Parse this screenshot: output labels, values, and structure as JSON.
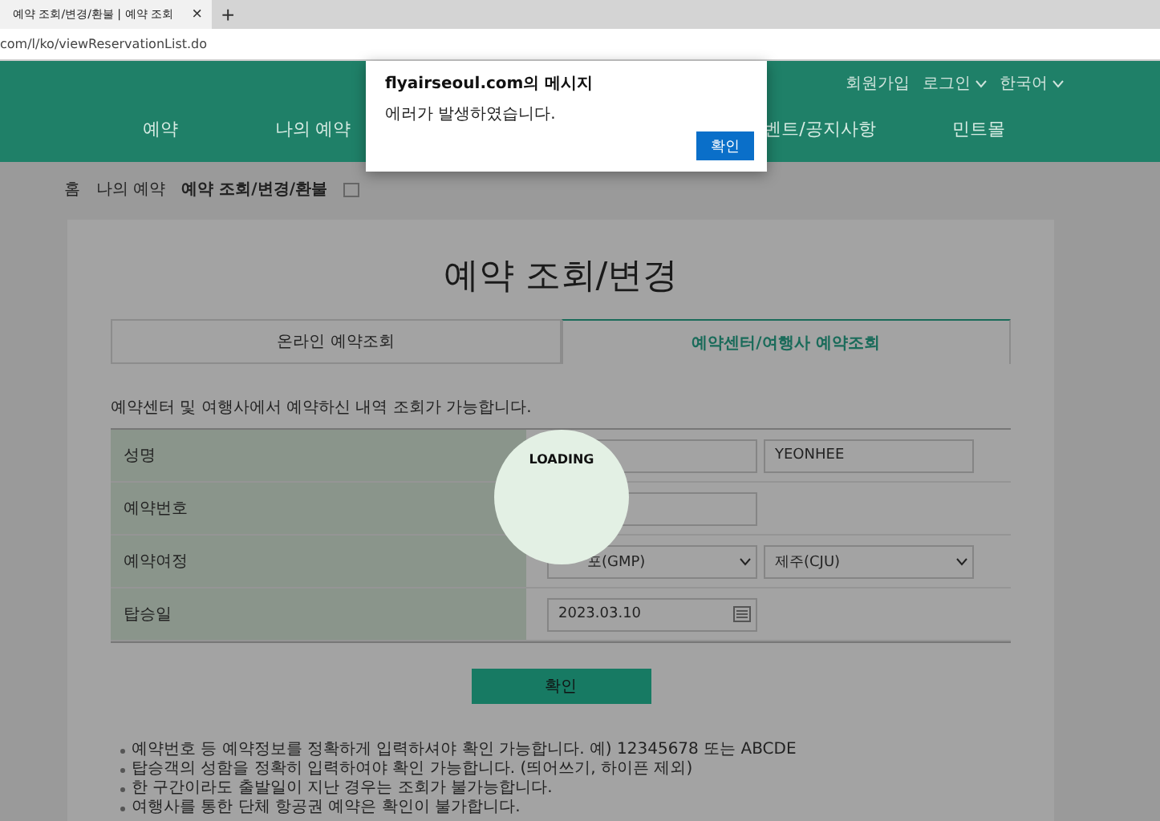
{
  "browser": {
    "tab_title": "예약 조회/변경/환불 | 예약 조회",
    "tab_close": "×",
    "new_tab": "+",
    "address": "com/l/ko/viewReservationList.do"
  },
  "header": {
    "top_links": [
      {
        "label": "회원가입",
        "caret": false
      },
      {
        "label": "로그인",
        "caret": true
      },
      {
        "label": "한국어",
        "caret": true
      }
    ],
    "nav": [
      "예약",
      "나의 예약",
      "벤트/공지사항",
      "민트몰"
    ]
  },
  "breadcrumb": [
    "홈",
    "나의 예약",
    "예약 조회/변경/환불"
  ],
  "dialog": {
    "title": "flyairseoul.com의 메시지",
    "message": "에러가 발생하였습니다.",
    "button": "확인"
  },
  "page_title": "예약 조회/변경",
  "tabs": [
    {
      "label": "온라인 예약조회",
      "selected": false
    },
    {
      "label": "예약센터/여행사 예약조회",
      "selected": true
    }
  ],
  "description": "예약센터 및 여행사에서 예약하신 내역 조회가 가능합니다.",
  "form": [
    {
      "label": "성명",
      "fields": [
        {
          "kind": "input"
        },
        {
          "kind": "input",
          "value": "YEONHEE"
        }
      ]
    },
    {
      "label": "예약번호",
      "fields": [
        {
          "kind": "input"
        }
      ]
    },
    {
      "label": "예약여정",
      "fields": [
        {
          "kind": "select",
          "value": "포(GMP)"
        },
        {
          "kind": "select",
          "value": "제주(CJU)"
        }
      ]
    },
    {
      "label": "탑승일",
      "fields": [
        {
          "kind": "date",
          "value": "2023.03.10"
        }
      ]
    }
  ],
  "loading": "LOADING",
  "submit": "확인",
  "notes": [
    "예약번호 등 예약정보를 정확하게 입력하셔야 확인 가능합니다. 예) 12345678 또는 ABCDE",
    "탑승객의 성함을 정확히 입력하여야 확인 가능합니다. (띄어쓰기, 하이픈 제외)",
    "한 구간이라도 출발일이 지난 경우는 조회가 불가능합니다.",
    "여행사를 통한 단체 항공권 예약은 확인이 불가합니다."
  ]
}
